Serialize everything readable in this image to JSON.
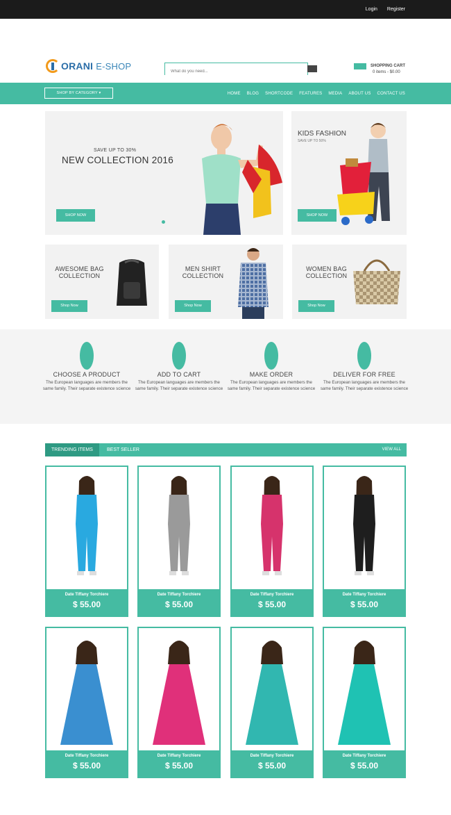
{
  "topbar": {
    "login": "Login",
    "register": "Register"
  },
  "logo": {
    "part1": "ORANI",
    "part2": "E-SHOP"
  },
  "search": {
    "placeholder": "What do you need..."
  },
  "cart": {
    "title": "SHOPPING CART",
    "summary": "0 items - $0.00"
  },
  "nav": {
    "category_button": "SHOP BY CATEGORY ▾",
    "items": [
      "HOME",
      "BLOG",
      "SHORTCODE",
      "FEATURES",
      "MEDIA",
      "ABOUT US",
      "CONTACT US"
    ]
  },
  "hero": {
    "subtitle": "SAVE UP TO 30%",
    "title": "NEW COLLECTION 2016",
    "button": "SHOP NOW"
  },
  "kids_banner": {
    "title": "KIDS FASHION",
    "subtitle": "SAVE UP TO 50%",
    "button": "SHOP NOW"
  },
  "mini_banners": [
    {
      "line1": "AWESOME BAG",
      "line2": "COLLECTION",
      "button": "Shop Now"
    },
    {
      "line1": "MEN SHIRT",
      "line2": "COLLECTION",
      "button": "Shop Now"
    },
    {
      "line1": "WOMEN BAG",
      "line2": "COLLECTION",
      "button": "Shop Now"
    }
  ],
  "features": [
    {
      "title": "CHOOSE A PRODUCT",
      "desc": "The European languages are members the same family. Their separate existence science"
    },
    {
      "title": "ADD TO CART",
      "desc": "The European languages are members the same family. Their separate existence science"
    },
    {
      "title": "MAKE ORDER",
      "desc": "The European languages are members the same family. Their separate existence science"
    },
    {
      "title": "DELIVER FOR FREE",
      "desc": "The European languages are members the same family. Their separate existence science"
    }
  ],
  "tabs": {
    "trending": "TRENDING ITEMS",
    "best": "BEST SELLER",
    "view_all": "VIEW ALL"
  },
  "products": [
    {
      "name": "Date Tiffany Torchiere",
      "price": "$ 55.00",
      "color": "#29a9e0"
    },
    {
      "name": "Date Tiffany Torchiere",
      "price": "$ 55.00",
      "color": "#9a9a9a"
    },
    {
      "name": "Date Tiffany Torchiere",
      "price": "$ 55.00",
      "color": "#d6336c"
    },
    {
      "name": "Date Tiffany Torchiere",
      "price": "$ 55.00",
      "color": "#1e1e1e"
    },
    {
      "name": "Date Tiffany Torchiere",
      "price": "$ 55.00",
      "color": "#3a8fd0"
    },
    {
      "name": "Date Tiffany Torchiere",
      "price": "$ 55.00",
      "color": "#e0307a"
    },
    {
      "name": "Date Tiffany Torchiere",
      "price": "$ 55.00",
      "color": "#31b7b0"
    },
    {
      "name": "Date Tiffany Torchiere",
      "price": "$ 55.00",
      "color": "#1fc2b3"
    }
  ],
  "colors": {
    "accent": "#45bba2",
    "dark": "#1b1b1b"
  }
}
